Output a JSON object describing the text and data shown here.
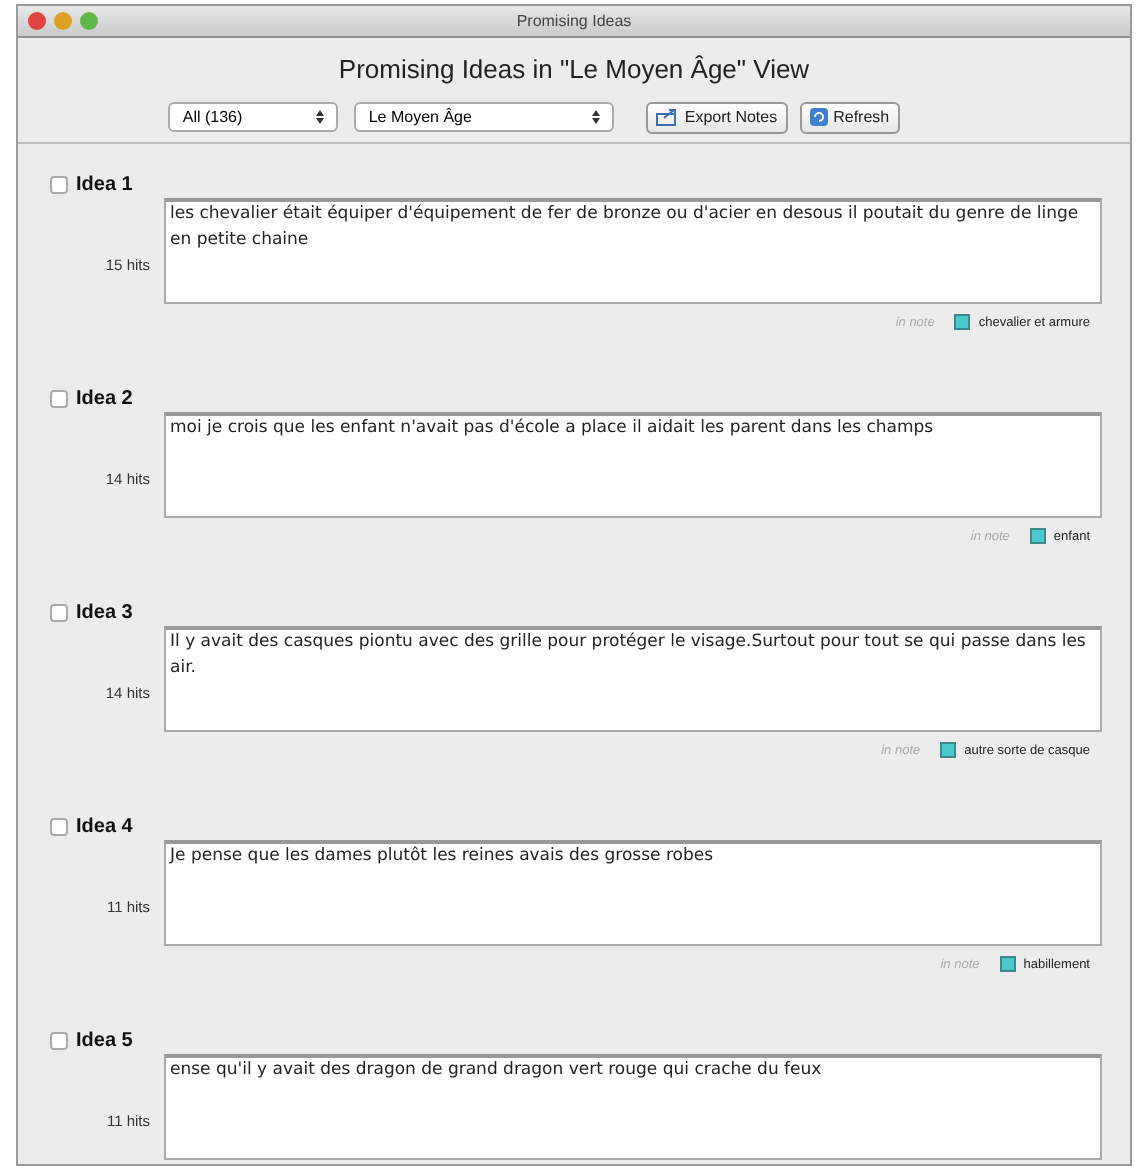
{
  "window": {
    "title": "Promising Ideas"
  },
  "heading": "Promising Ideas in \"Le Moyen Âge\" View",
  "toolbar": {
    "filter": "All (136)",
    "view": "Le Moyen Âge",
    "buttons": [
      {
        "kind": "export",
        "label": "Export Notes"
      },
      {
        "kind": "refresh",
        "label": "Refresh"
      }
    ]
  },
  "ideas": [
    {
      "title": "Idea 1",
      "checked": false,
      "hits": "15 hits",
      "text": "les chevalier était équiper d'équipement de fer de bronze ou d'acier en desous il poutait du genre de linge en petite chaine",
      "in_note": "in note",
      "note": "chevalier et armure",
      "color": "#4cc9cf"
    },
    {
      "title": "Idea 2",
      "checked": false,
      "hits": "14 hits",
      "text": "moi je crois que les enfant n'avait pas d'école a place il aidait les parent dans les champs",
      "in_note": "in note",
      "note": "enfant",
      "color": "#4cc9cf"
    },
    {
      "title": "Idea 3",
      "checked": false,
      "hits": "14 hits",
      "text": "Il y avait des casques piontu avec  des grille pour protéger le visage.Surtout pour tout se qui passe dans les air.",
      "in_note": "in note",
      "note": "autre sorte de casque",
      "color": "#4cc9cf"
    },
    {
      "title": "Idea 4",
      "checked": false,
      "hits": "11 hits",
      "text": "Je pense que les dames plutôt les reines avais des grosse robes",
      "in_note": "in note",
      "note": "habillement",
      "color": "#4cc9cf"
    },
    {
      "title": "Idea 5",
      "checked": false,
      "hits": "11 hits",
      "text": "ense qu'il y avait des dragon de grand dragon vert rouge qui crache du feux"
    }
  ]
}
